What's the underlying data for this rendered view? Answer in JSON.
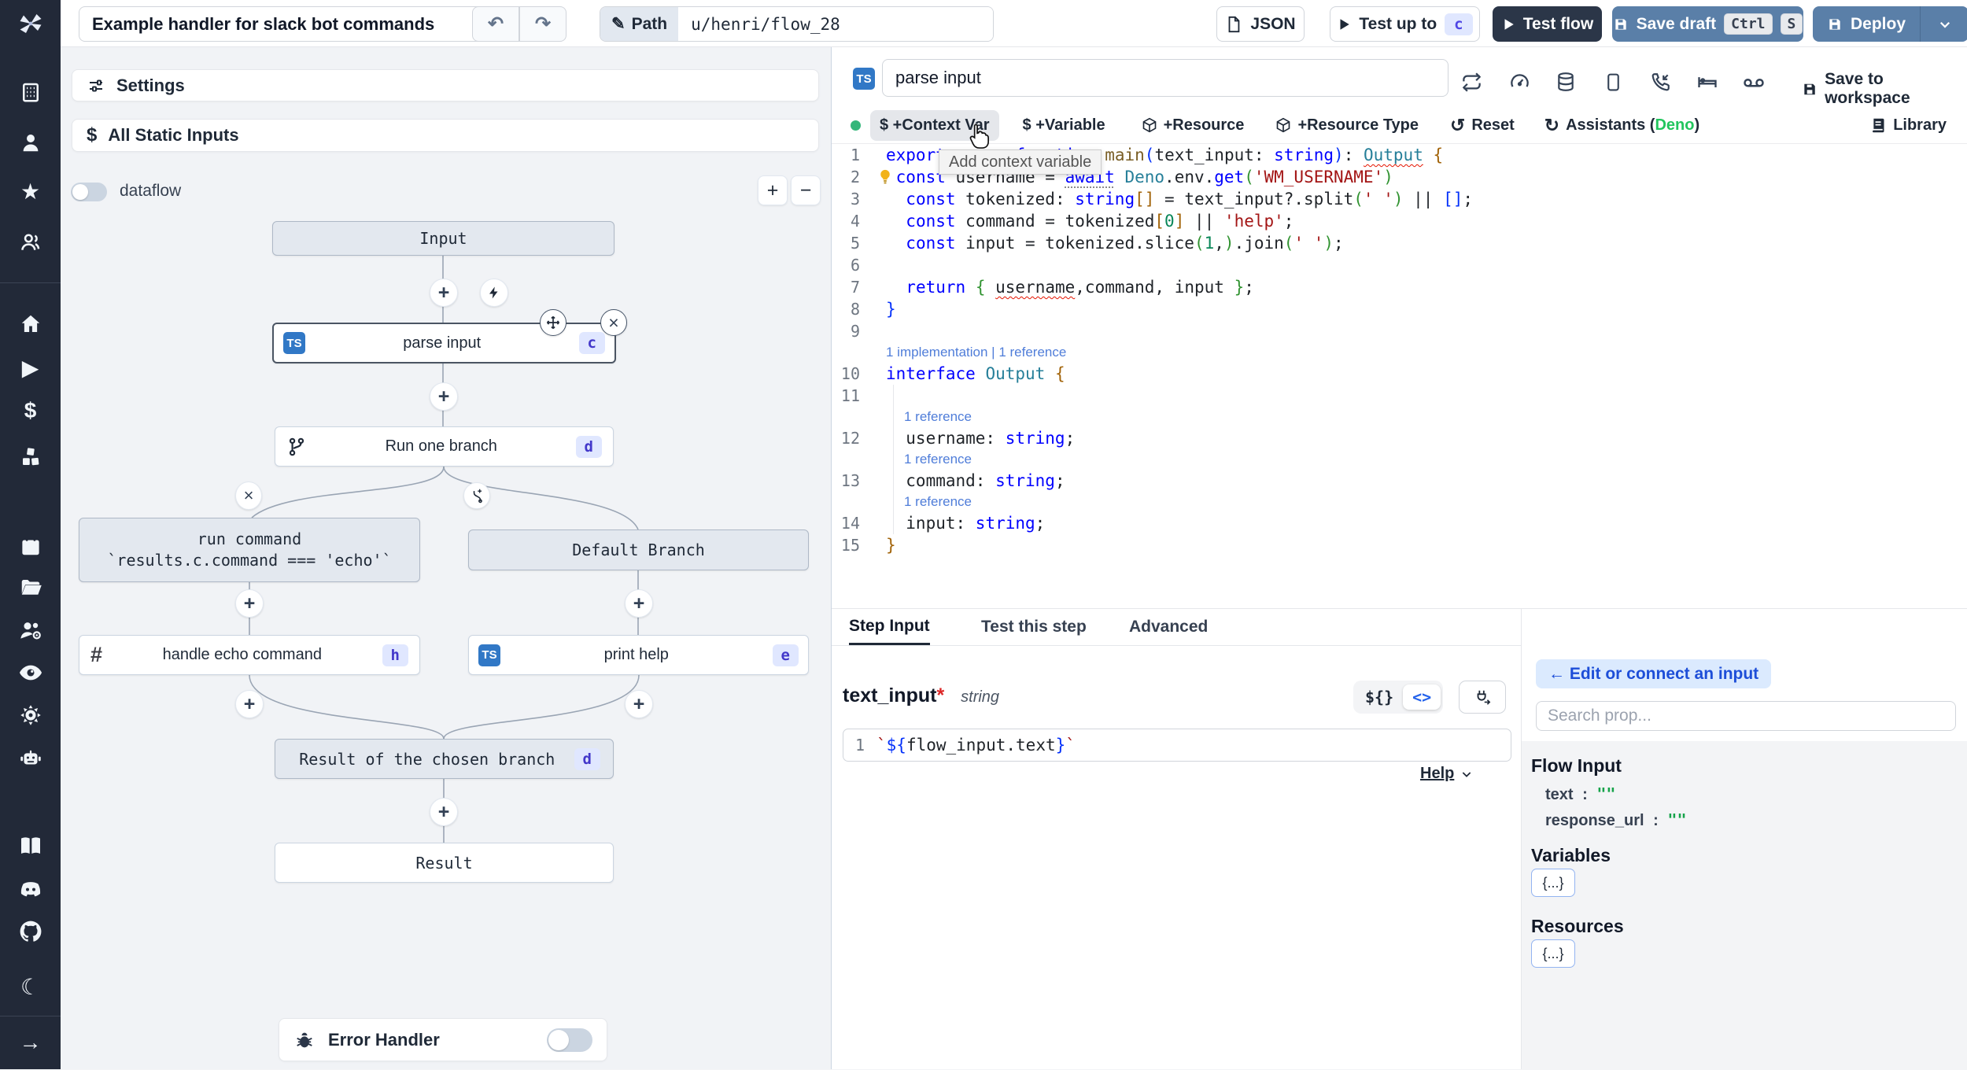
{
  "topbar": {
    "title_value": "Example handler for slack bot commands",
    "undo_icon": "↶",
    "redo_icon": "↷",
    "path_label": "Path",
    "pencil_icon": "✎",
    "path_value": "u/henri/flow_28",
    "json_label": "JSON",
    "test_up_to_label": "Test up to",
    "test_up_to_step": "c",
    "test_flow_label": "Test flow",
    "save_draft_label": "Save draft",
    "kbd_ctrl": "Ctrl",
    "kbd_s": "S",
    "deploy_label": "Deploy"
  },
  "sidebar": {
    "icons": [
      "workspace-building",
      "user",
      "star",
      "groups",
      "home",
      "runs-play",
      "variables-dollar",
      "resources-cubes",
      "schedules-calendar",
      "folders",
      "workers-group-gear",
      "audit-eye",
      "settings-gear",
      "ai-robot",
      "docs-book",
      "discord",
      "github",
      "dark-mode-moon",
      "expand-arrow"
    ],
    "star_glyph": "★",
    "play_glyph": "▶",
    "dollar_glyph": "$",
    "moon_glyph": "☾",
    "arrow_glyph": "→"
  },
  "flow": {
    "settings_label": "Settings",
    "static_inputs_label": "All Static Inputs",
    "static_inputs_icon": "$",
    "dataflow_label": "dataflow",
    "zoom_in": "+",
    "zoom_out": "−",
    "nodes": {
      "input": "Input",
      "parse": {
        "lang": "TS",
        "label": "parse input",
        "badge": "c"
      },
      "branchone": {
        "label": "Run one branch",
        "badge": "d"
      },
      "runcmd_line1": "run command",
      "runcmd_line2": "`results.c.command === 'echo'`",
      "default_branch": "Default Branch",
      "echo": {
        "icon": "#",
        "label": "handle echo command",
        "badge": "h"
      },
      "printhelp": {
        "lang": "TS",
        "label": "print help",
        "badge": "e"
      },
      "resultchosen": {
        "label": "Result of the chosen branch",
        "badge": "d"
      },
      "result": "Result"
    },
    "remove_branch_icon": "×",
    "error_handler_label": "Error Handler"
  },
  "editor": {
    "lang_badge": "TS",
    "step_name_value": "parse input",
    "header_icons": [
      "repeat",
      "gauge",
      "database",
      "smartphone",
      "phone-incoming",
      "bed",
      "voicemail"
    ],
    "save_workspace_label": "Save to workspace",
    "toolbar": {
      "context_var": "$ +Context Var",
      "variable": "$ +Variable",
      "resource": "+Resource",
      "resource_type": "+Resource Type",
      "reset": "Reset",
      "assistants_prefix": "Assistants (",
      "assistants_engine": "Deno",
      "assistants_suffix": ")",
      "library": "Library",
      "reset_icon": "↺",
      "refresh_icon": "↻",
      "repeat_glyph": "⇄"
    },
    "tooltip": "Add context variable",
    "lines": [
      {
        "n": "1",
        "t": [
          [
            "k",
            "export"
          ],
          [
            "pl",
            " "
          ],
          [
            "k",
            "async"
          ],
          [
            "pl",
            " "
          ],
          [
            "k",
            "function"
          ],
          [
            "pl",
            " "
          ],
          [
            "fn",
            "main"
          ],
          [
            "pb",
            "("
          ],
          [
            "pl",
            "text_input"
          ],
          [
            "pl",
            ": "
          ],
          [
            "k",
            "string"
          ],
          [
            "pb",
            ")"
          ],
          [
            "pl",
            ": "
          ],
          [
            "tysq",
            "Output"
          ],
          [
            "pl",
            " "
          ],
          [
            "bg",
            "{"
          ]
        ]
      },
      {
        "n": "2",
        "bulb": true,
        "t": [
          [
            "pl",
            " "
          ],
          [
            "k",
            "const"
          ],
          [
            "pl",
            " username = "
          ],
          [
            "kund",
            "await"
          ],
          [
            "pl",
            " "
          ],
          [
            "ty",
            "Deno"
          ],
          [
            "pl",
            ".env."
          ],
          [
            "k",
            "get"
          ],
          [
            "gg",
            "("
          ],
          [
            "s",
            "'WM_USERNAME'"
          ],
          [
            "gg",
            ")"
          ]
        ]
      },
      {
        "n": "3",
        "t": [
          [
            "pl",
            "  "
          ],
          [
            "k",
            "const"
          ],
          [
            "pl",
            " tokenized: "
          ],
          [
            "k",
            "string"
          ],
          [
            "bg",
            "[]"
          ],
          [
            "pl",
            " = text_input?.split"
          ],
          [
            "gg",
            "("
          ],
          [
            "s",
            "' '"
          ],
          [
            "gg",
            ")"
          ],
          [
            "pl",
            " || "
          ],
          [
            "pb",
            "[]"
          ],
          [
            "pl",
            ";"
          ]
        ]
      },
      {
        "n": "4",
        "t": [
          [
            "pl",
            "  "
          ],
          [
            "k",
            "const"
          ],
          [
            "pl",
            " command = tokenized"
          ],
          [
            "bg",
            "["
          ],
          [
            "n2",
            "0"
          ],
          [
            "bg",
            "]"
          ],
          [
            "pl",
            " || "
          ],
          [
            "s",
            "'help'"
          ],
          [
            "pl",
            ";"
          ]
        ]
      },
      {
        "n": "5",
        "t": [
          [
            "pl",
            "  "
          ],
          [
            "k",
            "const"
          ],
          [
            "pl",
            " input = tokenized.slice"
          ],
          [
            "gg",
            "("
          ],
          [
            "n2",
            "1"
          ],
          [
            "pl",
            ","
          ],
          [
            "gg",
            ")"
          ],
          [
            "pl",
            ".join"
          ],
          [
            "gg",
            "("
          ],
          [
            "s",
            "' '"
          ],
          [
            "gg",
            ")"
          ],
          [
            "pl",
            ";"
          ]
        ]
      },
      {
        "n": "6",
        "t": []
      },
      {
        "n": "7",
        "t": [
          [
            "pl",
            "  "
          ],
          [
            "k",
            "return"
          ],
          [
            "pl",
            " "
          ],
          [
            "gg",
            "{"
          ],
          [
            "pl",
            " "
          ],
          [
            "plsq",
            "username"
          ],
          [
            "pl",
            ",command, input "
          ],
          [
            "gg",
            "}"
          ],
          [
            "pl",
            ";"
          ]
        ]
      },
      {
        "n": "8",
        "t": [
          [
            "pb",
            "}"
          ]
        ]
      },
      {
        "n": "9",
        "t": []
      },
      {
        "lens": "1 implementation | 1 reference",
        "ind": 0
      },
      {
        "n": "10",
        "t": [
          [
            "k",
            "interface"
          ],
          [
            "pl",
            " "
          ],
          [
            "ty",
            "Output"
          ],
          [
            "pl",
            " "
          ],
          [
            "bg",
            "{"
          ]
        ]
      },
      {
        "n": "11",
        "t": [],
        "guide": true
      },
      {
        "lens": "1 reference",
        "ind": 1,
        "guide": true
      },
      {
        "n": "12",
        "t": [
          [
            "pl",
            "  username: "
          ],
          [
            "k",
            "string"
          ],
          [
            "pl",
            ";"
          ]
        ],
        "guide": true
      },
      {
        "lens": "1 reference",
        "ind": 1,
        "guide": true
      },
      {
        "n": "13",
        "t": [
          [
            "pl",
            "  command: "
          ],
          [
            "k",
            "string"
          ],
          [
            "pl",
            ";"
          ]
        ],
        "guide": true
      },
      {
        "lens": "1 reference",
        "ind": 1,
        "guide": true
      },
      {
        "n": "14",
        "t": [
          [
            "pl",
            "  input: "
          ],
          [
            "k",
            "string"
          ],
          [
            "pl",
            ";"
          ]
        ],
        "guide": true
      },
      {
        "n": "15",
        "t": [
          [
            "bg",
            "}"
          ]
        ]
      }
    ]
  },
  "step_panel": {
    "tabs": [
      "Step Input",
      "Test this step",
      "Advanced"
    ],
    "field_name": "text_input",
    "required_mark": "*",
    "field_type": "string",
    "mode_template": "${}",
    "mode_code": "<>",
    "expr_line_number": "1",
    "expr_tokens": [
      [
        "s",
        "`"
      ],
      [
        "pb",
        "${"
      ],
      [
        "pl",
        "flow_input.text"
      ],
      [
        "pb",
        "}"
      ],
      [
        "s",
        "`"
      ]
    ],
    "help_label": "Help"
  },
  "connect": {
    "back_label": "← Edit or connect an input",
    "search_placeholder": "Search prop...",
    "flow_input_title": "Flow Input",
    "props": [
      {
        "key": "text",
        "value": "\"\""
      },
      {
        "key": "response_url",
        "value": "\"\""
      }
    ],
    "variables_title": "Variables",
    "variables_button": "{...}",
    "resources_title": "Resources",
    "resources_button": "{...}"
  },
  "colors": {
    "accent_slate_button": "#5a7fa8",
    "dark_button": "#2b3648",
    "badge_bg": "#e0e7ff",
    "badge_text": "#4338ca",
    "ts_blue": "#3178c6",
    "deno_green": "#22c55e",
    "codelens_blue": "#4f7dd9",
    "string_red": "#a31515",
    "keyword_blue": "#0000ff",
    "sidebar_bg": "#222938"
  }
}
